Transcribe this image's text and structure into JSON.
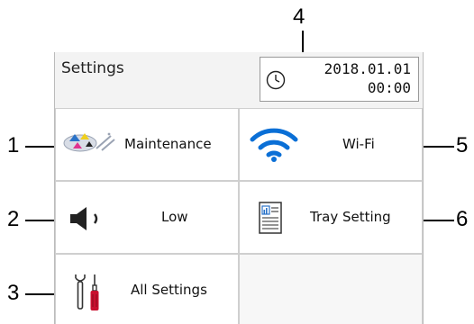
{
  "callouts": {
    "c1": "1",
    "c2": "2",
    "c3": "3",
    "c4": "4",
    "c5": "5",
    "c6": "6"
  },
  "screen": {
    "title": "Settings",
    "datetime": {
      "date": "2018.01.01",
      "time": "00:00"
    },
    "tiles": [
      {
        "label": "Maintenance",
        "icon": "ink-cartridge-icon"
      },
      {
        "label": "Wi-Fi",
        "icon": "wifi-icon"
      },
      {
        "label": "Low",
        "icon": "speaker-icon"
      },
      {
        "label": "Tray Setting",
        "icon": "tray-document-icon"
      },
      {
        "label": "All Settings",
        "icon": "tools-icon"
      }
    ]
  },
  "colors": {
    "wifi": "#0a6fd6",
    "tools_red": "#c8102e"
  }
}
